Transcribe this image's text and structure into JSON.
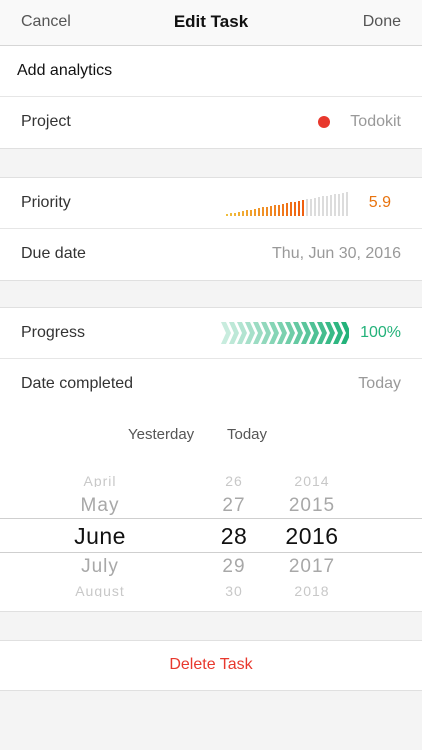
{
  "nav": {
    "cancel": "Cancel",
    "title": "Edit Task",
    "done": "Done"
  },
  "task": {
    "title": "Add analytics"
  },
  "project": {
    "label": "Project",
    "value": "Todokit",
    "color": "#e8382d"
  },
  "priority": {
    "label": "Priority",
    "value": "5.9",
    "level": 5.9,
    "max": 10
  },
  "due": {
    "label": "Due date",
    "value": "Thu, Jun 30, 2016"
  },
  "progress": {
    "label": "Progress",
    "value": "100%",
    "percent": 100
  },
  "completed": {
    "label": "Date completed",
    "value": "Today"
  },
  "picker": {
    "yesterday": "Yesterday",
    "today": "Today",
    "months": [
      "April",
      "May",
      "June",
      "July",
      "August"
    ],
    "days": [
      "26",
      "27",
      "28",
      "29",
      "30"
    ],
    "years": [
      "2014",
      "2015",
      "2016",
      "2017",
      "2018"
    ],
    "selected_index": 2
  },
  "delete": {
    "label": "Delete Task"
  },
  "colors": {
    "accent_orange": "#e8730e",
    "accent_green": "#23b27a",
    "destructive": "#e8382d"
  }
}
